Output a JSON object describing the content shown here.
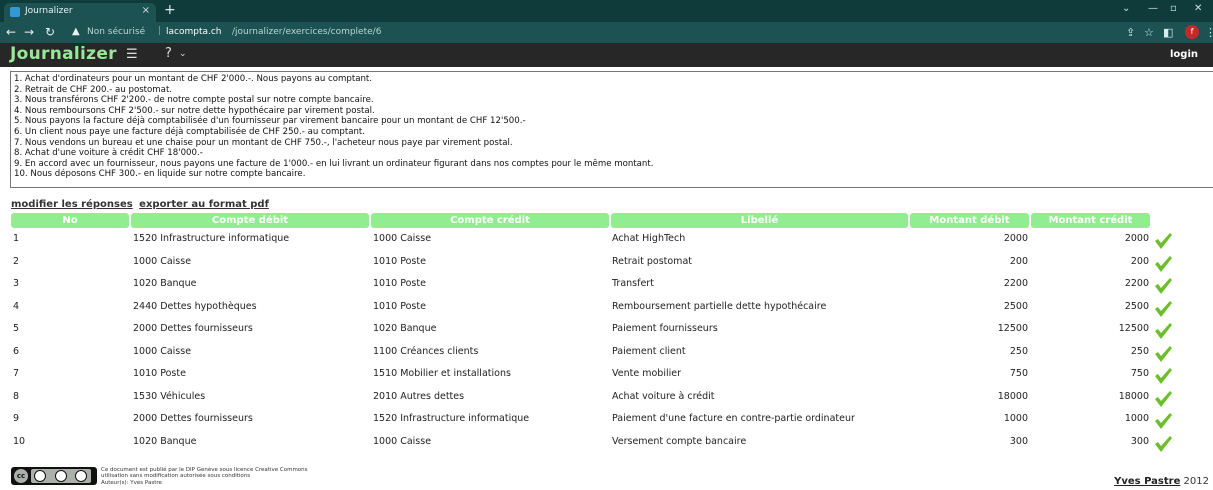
{
  "browser": {
    "tab_title": "Journalizer",
    "tab_close": "×",
    "new_tab": "+",
    "insecure_label": "Non sécurisé",
    "url_host": "lacompta.ch",
    "url_path": "/journalizer/exercices/complete/6",
    "profile_initial": "f",
    "accent": "#1c5252"
  },
  "app": {
    "logo": "Journalizer",
    "help": "?",
    "login": "login",
    "brand_color": "#97e897"
  },
  "statement": [
    "1. Achat d'ordinateurs pour un montant de CHF 2'000.-. Nous payons au comptant.",
    "2. Retrait de CHF 200.- au postomat.",
    "3. Nous transférons CHF 2'200.- de notre compte postal sur notre compte bancaire.",
    "4. Nous remboursons CHF 2'500.- sur notre dette hypothécaire par virement postal.",
    "5. Nous payons la facture déjà  comptabilisée d'un fournisseur par virement bancaire pour un montant de CHF 12'500.-",
    "6. Un client nous paye une facture déjà  comptabilisée de CHF 250.- au comptant.",
    "7. Nous vendons un bureau et une chaise pour un montant de CHF 750.-, l'acheteur nous paye par virement postal.",
    "8. Achat d'une voiture à  crédit CHF 18'000.-",
    "9. En accord avec un fournisseur, nous payons une facture de 1'000.- en lui livrant un ordinateur figurant dans nos comptes pour le même montant.",
    "10. Nous déposons CHF 300.- en liquide sur notre compte bancaire."
  ],
  "links": {
    "modify": "modifier les réponses",
    "export": "exporter au format pdf"
  },
  "table": {
    "headers": [
      "No",
      "Compte débit",
      "Compte crédit",
      "Libellé",
      "Montant débit",
      "Montant crédit"
    ],
    "header_color": "#90ee90",
    "rows": [
      {
        "no": "1",
        "debit": "1520 Infrastructure informatique",
        "credit": "1000 Caisse",
        "label": "Achat HighTech",
        "amount_debit": "2000",
        "amount_credit": "2000",
        "status": "correct"
      },
      {
        "no": "2",
        "debit": "1000 Caisse",
        "credit": "1010 Poste",
        "label": "Retrait postomat",
        "amount_debit": "200",
        "amount_credit": "200",
        "status": "correct"
      },
      {
        "no": "3",
        "debit": "1020 Banque",
        "credit": "1010 Poste",
        "label": "Transfert",
        "amount_debit": "2200",
        "amount_credit": "2200",
        "status": "correct"
      },
      {
        "no": "4",
        "debit": "2440 Dettes hypothèques",
        "credit": "1010 Poste",
        "label": "Remboursement partielle dette hypothécaire",
        "amount_debit": "2500",
        "amount_credit": "2500",
        "status": "correct"
      },
      {
        "no": "5",
        "debit": "2000 Dettes fournisseurs",
        "credit": "1020 Banque",
        "label": "Paiement fournisseurs",
        "amount_debit": "12500",
        "amount_credit": "12500",
        "status": "correct"
      },
      {
        "no": "6",
        "debit": "1000 Caisse",
        "credit": "1100 Créances clients",
        "label": "Paiement client",
        "amount_debit": "250",
        "amount_credit": "250",
        "status": "correct"
      },
      {
        "no": "7",
        "debit": "1010 Poste",
        "credit": "1510 Mobilier et installations",
        "label": "Vente mobilier",
        "amount_debit": "750",
        "amount_credit": "750",
        "status": "correct"
      },
      {
        "no": "8",
        "debit": "1530 Véhicules",
        "credit": "2010 Autres dettes",
        "label": "Achat voiture à crédit",
        "amount_debit": "18000",
        "amount_credit": "18000",
        "status": "correct"
      },
      {
        "no": "9",
        "debit": "2000 Dettes fournisseurs",
        "credit": "1520 Infrastructure informatique",
        "label": "Paiement d'une facture en contre-partie ordinateur",
        "amount_debit": "1000",
        "amount_credit": "1000",
        "status": "correct"
      },
      {
        "no": "10",
        "debit": "1020 Banque",
        "credit": "1000 Caisse",
        "label": "Versement compte bancaire",
        "amount_debit": "300",
        "amount_credit": "300",
        "status": "correct"
      }
    ],
    "check_color": "#6cbf2a"
  },
  "footer": {
    "license_lines": [
      "Ce document est publié par le DIP Genève sous licence Creative Commons",
      "utilisation sans modification autorisée sous conditions",
      "Auteur(s): Yves Pastre"
    ],
    "cc_label": "cc",
    "author_name": "Yves Pastre",
    "year": "2012"
  }
}
